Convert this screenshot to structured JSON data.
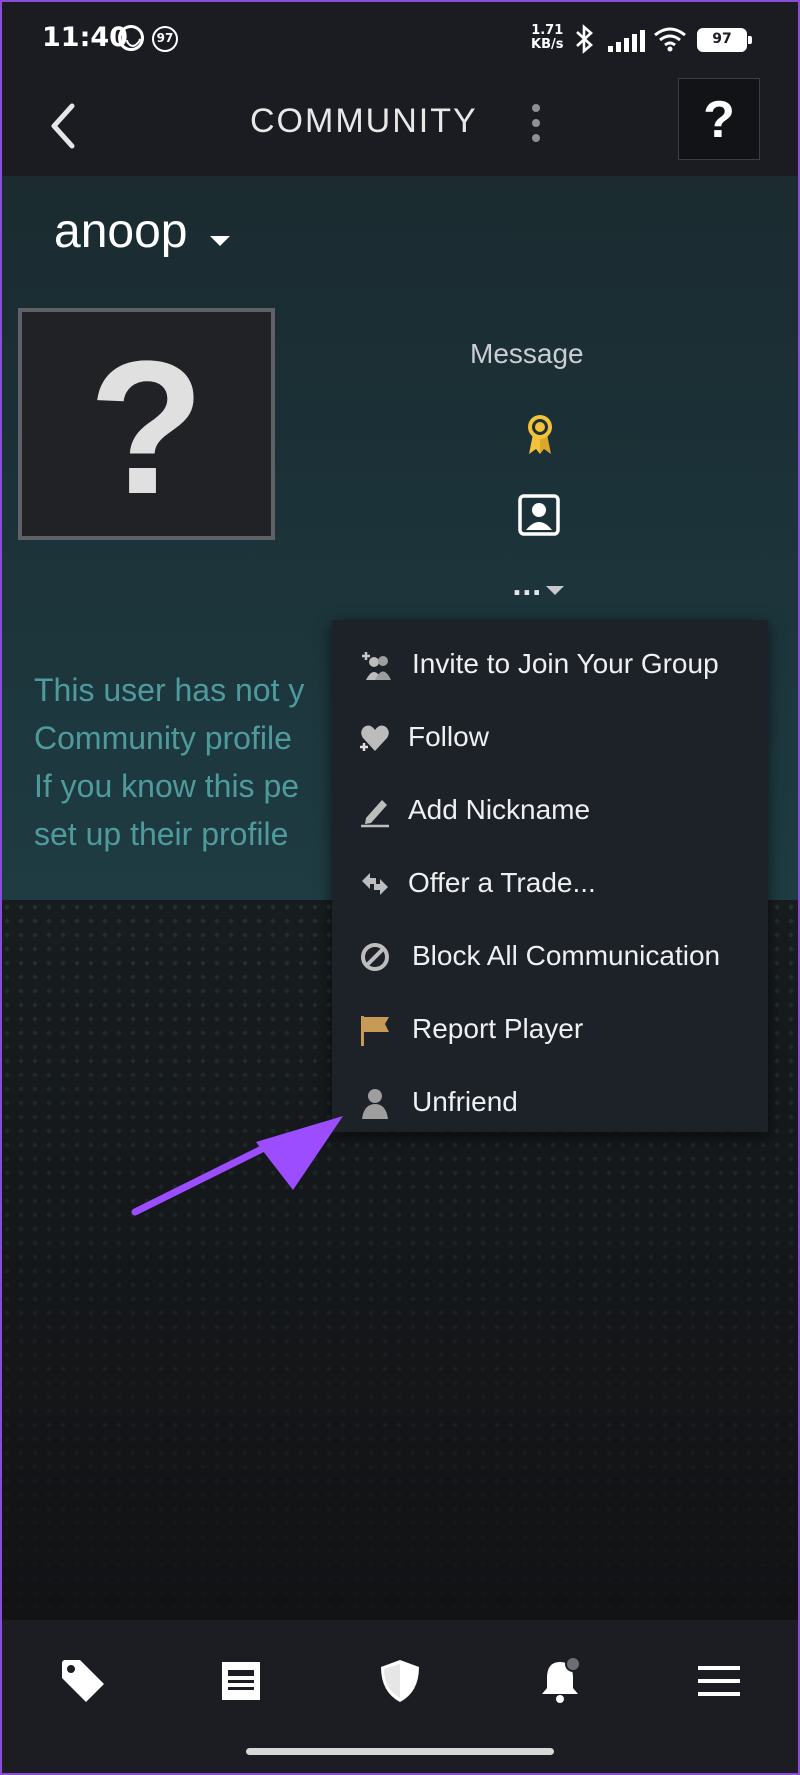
{
  "status_bar": {
    "time": "11:40",
    "notification_count": "97",
    "net_speed_value": "1.71",
    "net_speed_unit": "KB/s",
    "battery": "97"
  },
  "header": {
    "title": "COMMUNITY",
    "help_label": "?"
  },
  "profile": {
    "username": "anoop",
    "avatar_placeholder": "?",
    "message_label": "Message",
    "more_label": "...",
    "notice_text": "This user has not y\nCommunity profile\nIf you know this pe\nset up their profile"
  },
  "menu": {
    "items": [
      {
        "label": "Invite to Join Your Group",
        "icon": "group-invite-icon"
      },
      {
        "label": "Follow",
        "icon": "heart-follow-icon"
      },
      {
        "label": "Add Nickname",
        "icon": "pencil-icon"
      },
      {
        "label": "Offer a Trade...",
        "icon": "trade-icon"
      },
      {
        "label": "Block All Communication",
        "icon": "block-icon"
      },
      {
        "label": "Report Player",
        "icon": "flag-icon"
      },
      {
        "label": "Unfriend",
        "icon": "person-icon"
      }
    ]
  },
  "bottom_nav": {
    "items": [
      "tag-icon",
      "news-icon",
      "shield-icon",
      "bell-icon",
      "menu-icon"
    ]
  },
  "colors": {
    "annotation_arrow": "#9b4dff",
    "badge_gold": "#f2c23a",
    "notice_teal": "#4f9a9c",
    "report_flag": "#c79a55"
  }
}
